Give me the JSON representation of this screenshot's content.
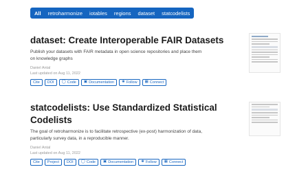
{
  "tags": [
    "All",
    "retroharmonize",
    "iotables",
    "regions",
    "dataset",
    "statcodelists"
  ],
  "posts": [
    {
      "title": "dataset: Create Interoperable FAIR Datasets",
      "summary_1": "Publish your datasets with FAIR metadata in open science repositories and place them",
      "summary_2": "on knowledge graphs",
      "author": "Daniel Antal",
      "updated": "Last updated on Aug 11, 2022",
      "buttons": [
        "Cite",
        "DOI",
        "Code",
        "Documentation",
        "Follow",
        "Connect"
      ]
    },
    {
      "title_1": "statcodelists: Use Standardized Statistical",
      "title_2": "Codelists",
      "summary_1": "The goal of retroharmonize is to facilitate retrospective (ex-post) harmonization of data,",
      "summary_2": "particularly survey data, in a reproducible manner.",
      "author": "Daniel Antal",
      "updated": "Last updated on Aug 11, 2022",
      "buttons": [
        "Cite",
        "Project",
        "DOI",
        "Code",
        "Documentation",
        "Follow",
        "Connect"
      ]
    }
  ],
  "icons": {
    "code": "github-icon",
    "documentation": "document-icon",
    "follow": "twitter-icon",
    "connect": "linkedin-icon"
  },
  "colors": {
    "accent": "#1565c0"
  }
}
